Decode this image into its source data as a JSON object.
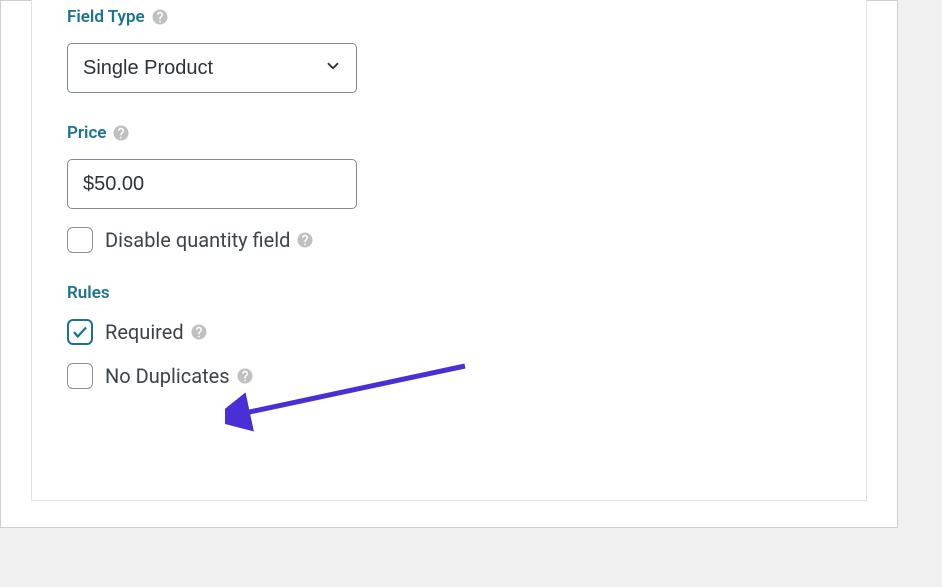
{
  "field_type": {
    "label": "Field Type",
    "value": "Single Product"
  },
  "price": {
    "label": "Price",
    "value": "$50.00"
  },
  "disable_quantity": {
    "label": "Disable quantity field",
    "checked": false
  },
  "rules": {
    "label": "Rules",
    "required": {
      "label": "Required",
      "checked": true
    },
    "no_duplicates": {
      "label": "No Duplicates",
      "checked": false
    }
  }
}
